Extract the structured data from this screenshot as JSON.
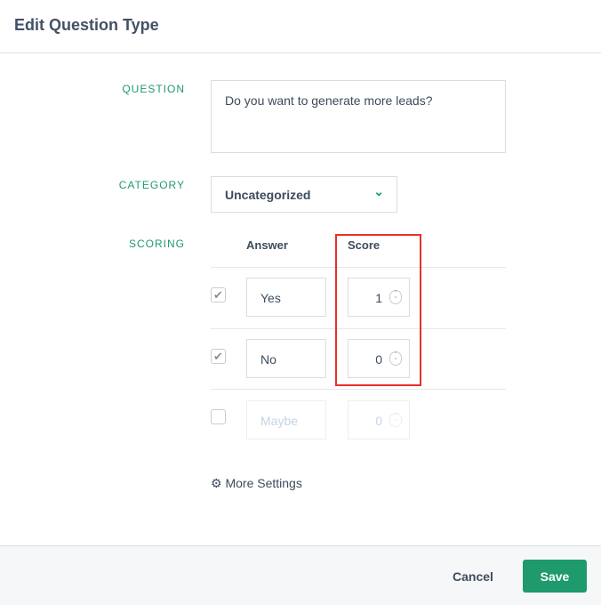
{
  "header": {
    "title": "Edit Question Type"
  },
  "form": {
    "question_label": "QUESTION",
    "question_value": "Do you want to generate more leads?",
    "category_label": "CATEGORY",
    "category_value": "Uncategorized",
    "scoring_label": "SCORING",
    "answer_header": "Answer",
    "score_header": "Score",
    "rows": [
      {
        "checked": true,
        "answer": "Yes",
        "score": "1"
      },
      {
        "checked": true,
        "answer": "No",
        "score": "0"
      },
      {
        "checked": false,
        "answer_placeholder": "Maybe",
        "score": "0"
      }
    ],
    "more_settings": "More Settings"
  },
  "footer": {
    "cancel": "Cancel",
    "save": "Save"
  },
  "colors": {
    "accent": "#1f9a6c",
    "highlight": "#e8302a"
  }
}
